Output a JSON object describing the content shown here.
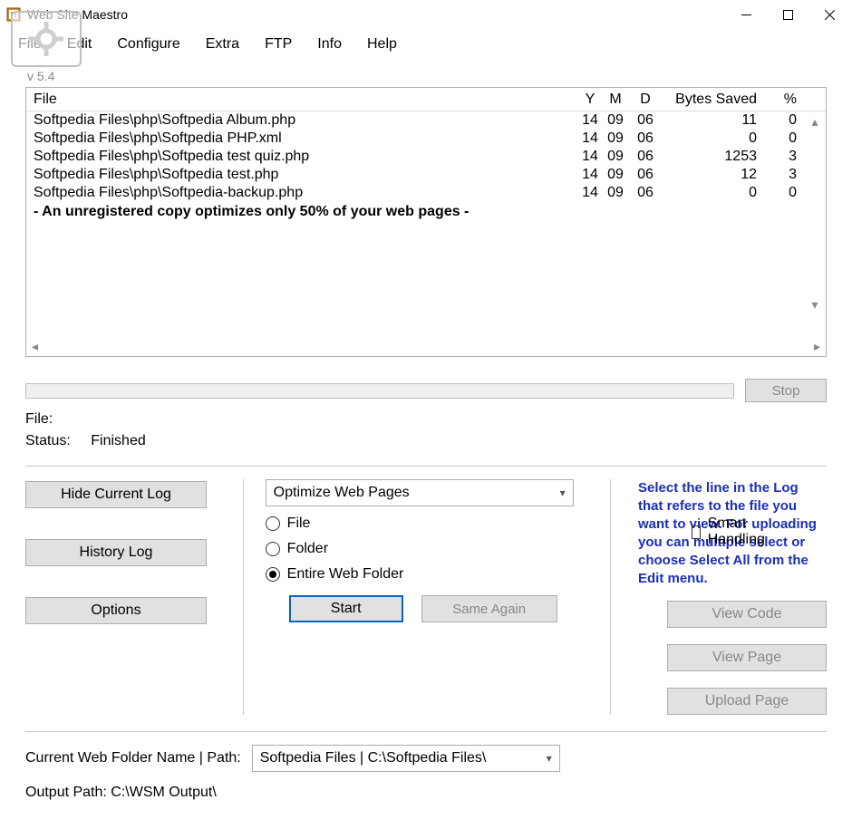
{
  "title": "Web Site Maestro",
  "menubar": [
    "File",
    "Edit",
    "Configure",
    "Extra",
    "FTP",
    "Info",
    "Help"
  ],
  "version": "v 5.4",
  "log": {
    "headers": {
      "file": "File",
      "y": "Y",
      "m": "M",
      "d": "D",
      "bytes": "Bytes Saved",
      "pct": "%"
    },
    "rows": [
      {
        "file": "Softpedia Files\\php\\Softpedia Album.php",
        "y": "14",
        "m": "09",
        "d": "06",
        "bytes": "11",
        "pct": "0"
      },
      {
        "file": "Softpedia Files\\php\\Softpedia PHP.xml",
        "y": "14",
        "m": "09",
        "d": "06",
        "bytes": "0",
        "pct": "0"
      },
      {
        "file": "Softpedia Files\\php\\Softpedia test quiz.php",
        "y": "14",
        "m": "09",
        "d": "06",
        "bytes": "1253",
        "pct": "3"
      },
      {
        "file": "Softpedia Files\\php\\Softpedia test.php",
        "y": "14",
        "m": "09",
        "d": "06",
        "bytes": "12",
        "pct": "3"
      },
      {
        "file": "Softpedia Files\\php\\Softpedia-backup.php",
        "y": "14",
        "m": "09",
        "d": "06",
        "bytes": "0",
        "pct": "0"
      }
    ],
    "note": "- An unregistered copy optimizes only 50% of your web pages -"
  },
  "stop_button": "Stop",
  "file_label": "File:",
  "status_label": "Status:",
  "status_value": "Finished",
  "left_buttons": {
    "hide": "Hide Current Log",
    "history": "History Log",
    "options": "Options"
  },
  "mode_select": "Optimize Web Pages",
  "radios": {
    "file": "File",
    "folder": "Folder",
    "entire": "Entire Web Folder",
    "selected": "entire"
  },
  "smart_handling": "Smart Handling",
  "start_button": "Start",
  "same_again": "Same Again",
  "hint": "Select the line in the Log that refers to the file you want to view. For uploading you can multiple select or choose Select All from the Edit menu.",
  "right_buttons": {
    "view_code": "View Code",
    "view_page": "View Page",
    "upload_page": "Upload Page"
  },
  "bottom": {
    "label": "Current Web Folder  Name | Path:",
    "value": "Softpedia Files  |  C:\\Softpedia Files\\",
    "output_label": "Output Path:",
    "output_value": "C:\\WSM Output\\"
  }
}
